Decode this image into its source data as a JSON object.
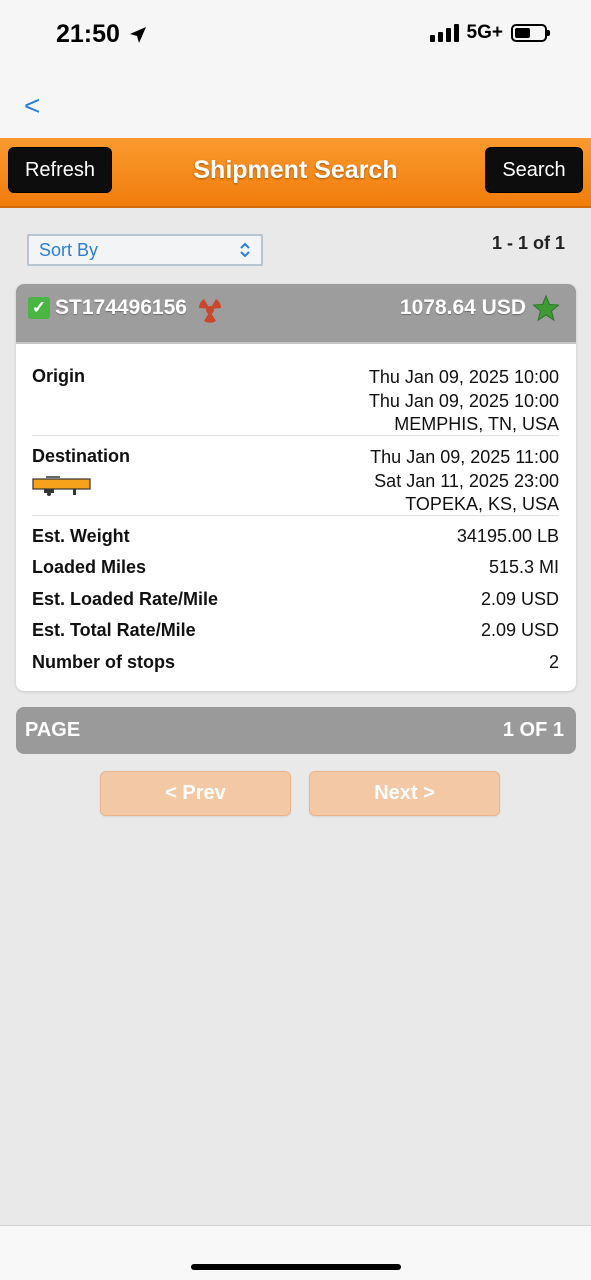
{
  "status_bar": {
    "time": "21:50",
    "network": "5G+",
    "icons": [
      "location-arrow-icon",
      "signal-icon",
      "battery-icon"
    ]
  },
  "nav": {
    "back_label": "<"
  },
  "header": {
    "title": "Shipment Search",
    "refresh_label": "Refresh",
    "search_label": "Search",
    "color": "#f6881a"
  },
  "sort": {
    "label": "Sort By"
  },
  "results": {
    "count_text": "1 - 1 of 1"
  },
  "shipment": {
    "id": "ST174496156",
    "price": "1078.64 USD",
    "origin": {
      "label": "Origin",
      "line1": "Thu Jan 09, 2025 10:00",
      "line2": "Thu Jan 09, 2025 10:00",
      "location": "MEMPHIS, TN, USA"
    },
    "destination": {
      "label": "Destination",
      "line1": "Thu Jan 09, 2025 11:00",
      "line2": "Sat Jan 11, 2025 23:00",
      "location": "TOPEKA, KS, USA"
    },
    "details": [
      {
        "label": "Est. Weight",
        "value": "34195.00 LB"
      },
      {
        "label": "Loaded Miles",
        "value": "515.3 MI"
      },
      {
        "label": "Est. Loaded Rate/Mile",
        "value": "2.09 USD"
      },
      {
        "label": "Est. Total Rate/Mile",
        "value": "2.09 USD"
      },
      {
        "label": "Number of stops",
        "value": "2"
      }
    ]
  },
  "pagination": {
    "label": "PAGE",
    "value": "1 OF 1",
    "prev_label": "< Prev",
    "next_label": "Next >"
  }
}
